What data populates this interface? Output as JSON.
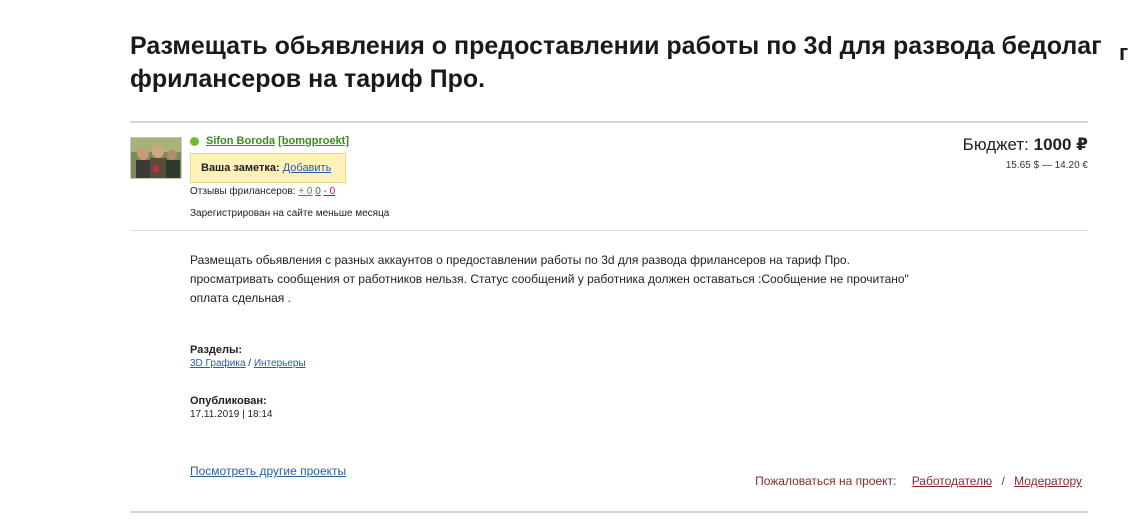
{
  "project": {
    "title": "Размещать обьявления о предоставлении работы по 3d для развода бедолаг фрилансеров на тариф Про.",
    "edge_char": "г"
  },
  "employer": {
    "name": "Sifon Boroda",
    "login": "[bomgproekt]",
    "note_label": "Ваша заметка:",
    "note_add": "Добавить",
    "reviews_label": "Отзывы фрилансеров:",
    "reviews_positive": "+ 0",
    "reviews_neutral": "0",
    "reviews_negative": "- 0",
    "registered": "Зарегистрирован на сайте меньше месяца",
    "status_color": "#6cbf2c"
  },
  "budget": {
    "label": "Бюджет:",
    "amount": "1000 ₽",
    "conversion": "15.65 $ — 14.20 €"
  },
  "description": {
    "line1": "Размещать обьявления с разных аккаунтов о предоставлении работы по 3d для развода фрилансеров на тариф Про.",
    "line2": "просматривать сообщения от работников нельзя.  Статус сообщений у работника должен оставаться :Сообщение не прочитано\"",
    "line3": "оплата сдельная ."
  },
  "sections": {
    "label": "Разделы:",
    "category": "3D Графика",
    "separator": "/",
    "subcategory": "Интерьеры"
  },
  "published": {
    "label": "Опубликован:",
    "value": "17.11.2019 | 18:14"
  },
  "footer": {
    "other_projects": "Посмотреть другие проекты",
    "complain_label": "Пожаловаться на проект:",
    "complain_employer": "Работодателю",
    "complain_separator": "/",
    "complain_moderator": "Модератору"
  }
}
